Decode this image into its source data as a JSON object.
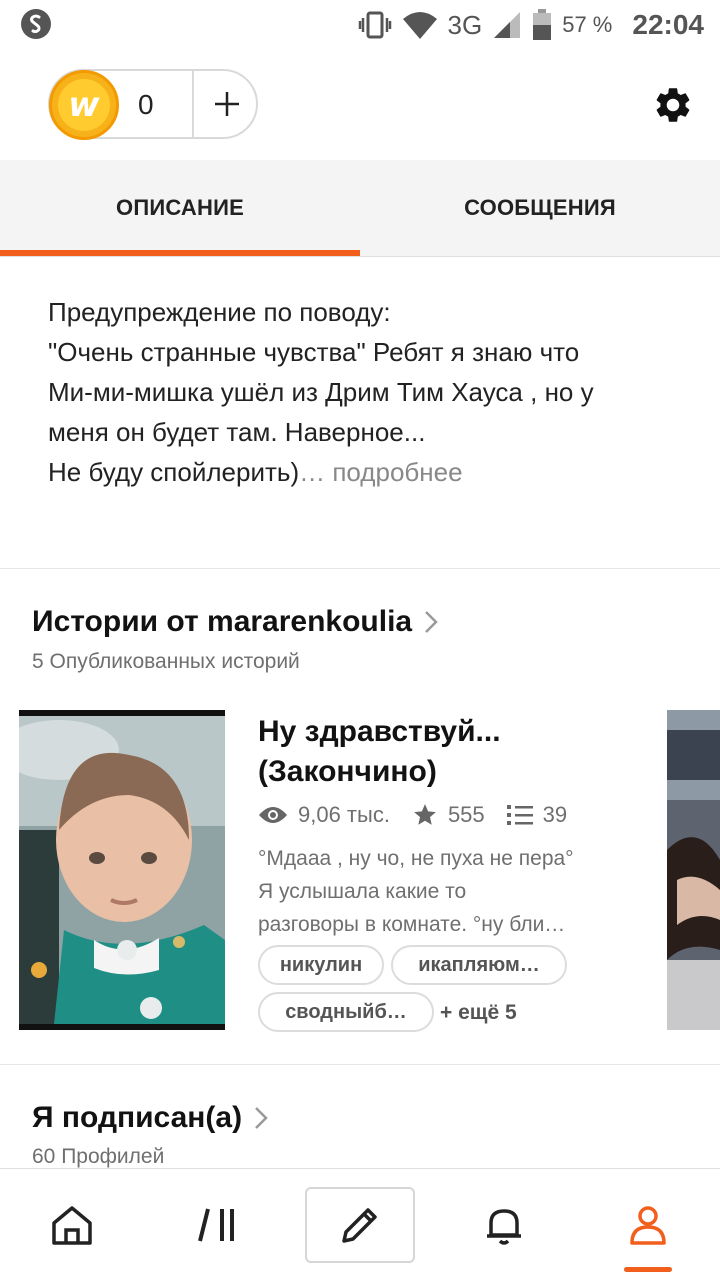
{
  "status_bar": {
    "network": "3G",
    "battery": "57 %",
    "time": "22:04"
  },
  "top_bar": {
    "coins": "0",
    "coin_icon_letter": "w",
    "add_label": "+"
  },
  "tabs": [
    {
      "label": "ОПИСАНИЕ",
      "active": true
    },
    {
      "label": "СООБЩЕНИЯ",
      "active": false
    }
  ],
  "description": {
    "lines": [
      "Предупреждение по поводу:",
      "\"Очень странные чувства\" Ребят я знаю что",
      "Ми-ми-мишка ушёл из Дрим Тим Хауса , но у",
      "меня он будет там. Наверное...",
      "Не буду спойлерить)"
    ],
    "ellipsis": "…",
    "more": "подробнее"
  },
  "stories_section": {
    "title": "Истории от mararenkoulia",
    "subtitle": "5 Опубликованных историй",
    "story": {
      "title_lines": [
        "Ну здравствуй...",
        "(Закончино)"
      ],
      "reads": "9,06 тыс.",
      "votes": "555",
      "parts": "39",
      "description_lines": [
        "°Мдааа , ну чо, не пуха не пера°",
        "Я услышала какие то",
        "разговоры в комнате. °ну бли…"
      ],
      "tags": [
        "никулин",
        "икапляюм…",
        "сводныйб…"
      ],
      "more_tags": "+ ещё 5"
    }
  },
  "following_section": {
    "title": "Я подписан(а)",
    "subtitle": "60 Профилей"
  },
  "colors": {
    "accent": "#f25f1d",
    "coin": "#f7b21a",
    "secondary_text": "#6f6f6f"
  },
  "icons": {
    "home": "home-icon",
    "library": "library-icon",
    "write": "pencil-icon",
    "notifications": "bell-icon",
    "profile": "profile-icon"
  }
}
